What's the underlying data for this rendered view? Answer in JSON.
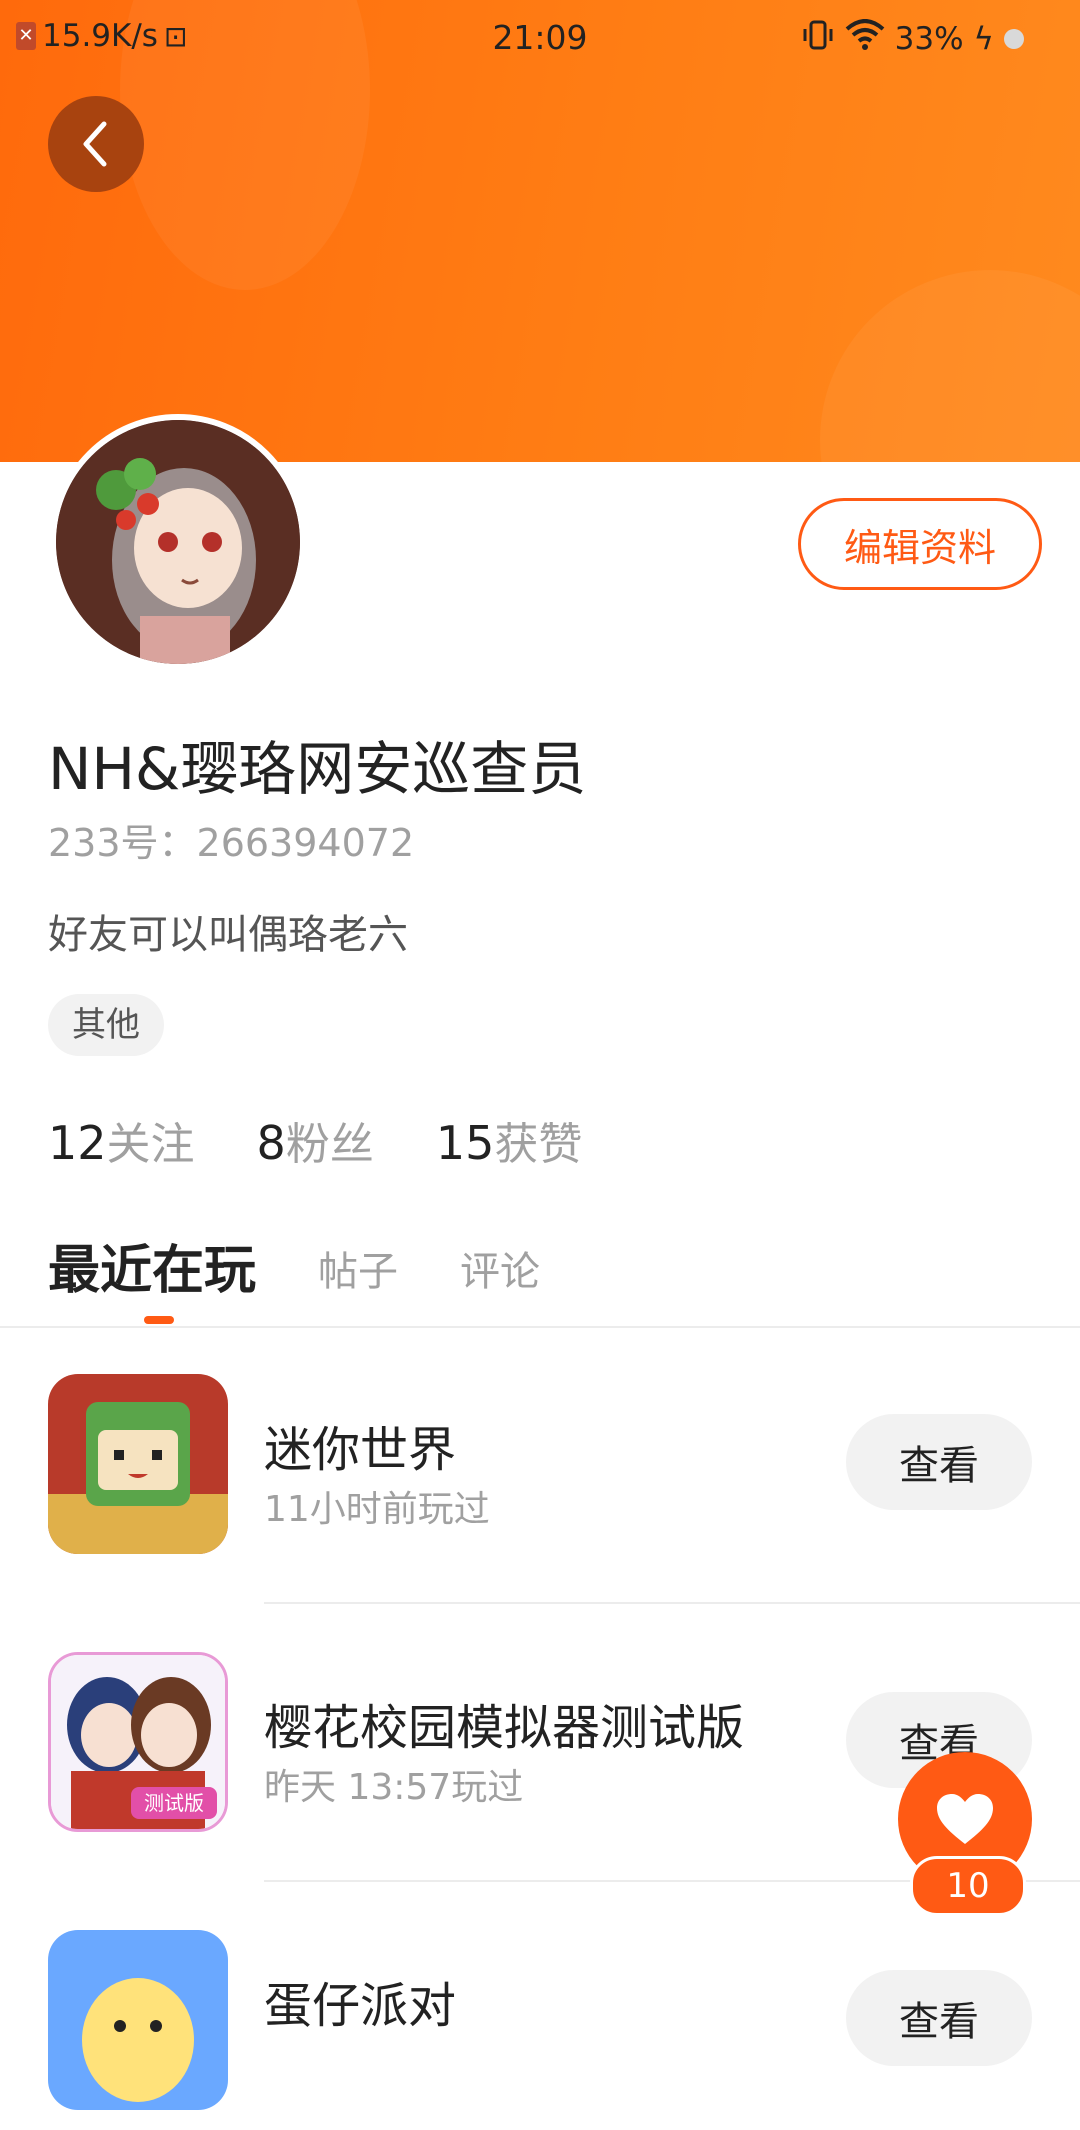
{
  "status_bar": {
    "speed": "15.9K/s",
    "time": "21:09",
    "battery": "33%",
    "icons": [
      "notification-x-icon",
      "storage-icon",
      "vibrate-icon",
      "wifi-icon",
      "charging-icon"
    ]
  },
  "colors": {
    "accent": "#ff5a14",
    "header_gradient_start": "#ff6a0c",
    "header_gradient_end": "#ff8a1e"
  },
  "profile": {
    "edit_label": "编辑资料",
    "username": "NH&璎珞网安巡查员",
    "uid": "233号：266394072",
    "bio": "好友可以叫偶珞老六",
    "tag": "其他"
  },
  "stats": [
    {
      "num": "12",
      "label": "关注"
    },
    {
      "num": "8",
      "label": "粉丝"
    },
    {
      "num": "15",
      "label": "获赞"
    }
  ],
  "tabs": [
    {
      "label": "最近在玩"
    },
    {
      "label": "帖子"
    },
    {
      "label": "评论"
    }
  ],
  "games": [
    {
      "name": "迷你世界",
      "time": "11小时前玩过",
      "button": "查看"
    },
    {
      "name": "樱花校园模拟器测试版",
      "time": "昨天 13:57玩过",
      "button": "查看",
      "icon_badge": "测试版"
    },
    {
      "name": "蛋仔派对",
      "time": "",
      "button": "查看"
    }
  ],
  "fab": {
    "count": "10"
  }
}
